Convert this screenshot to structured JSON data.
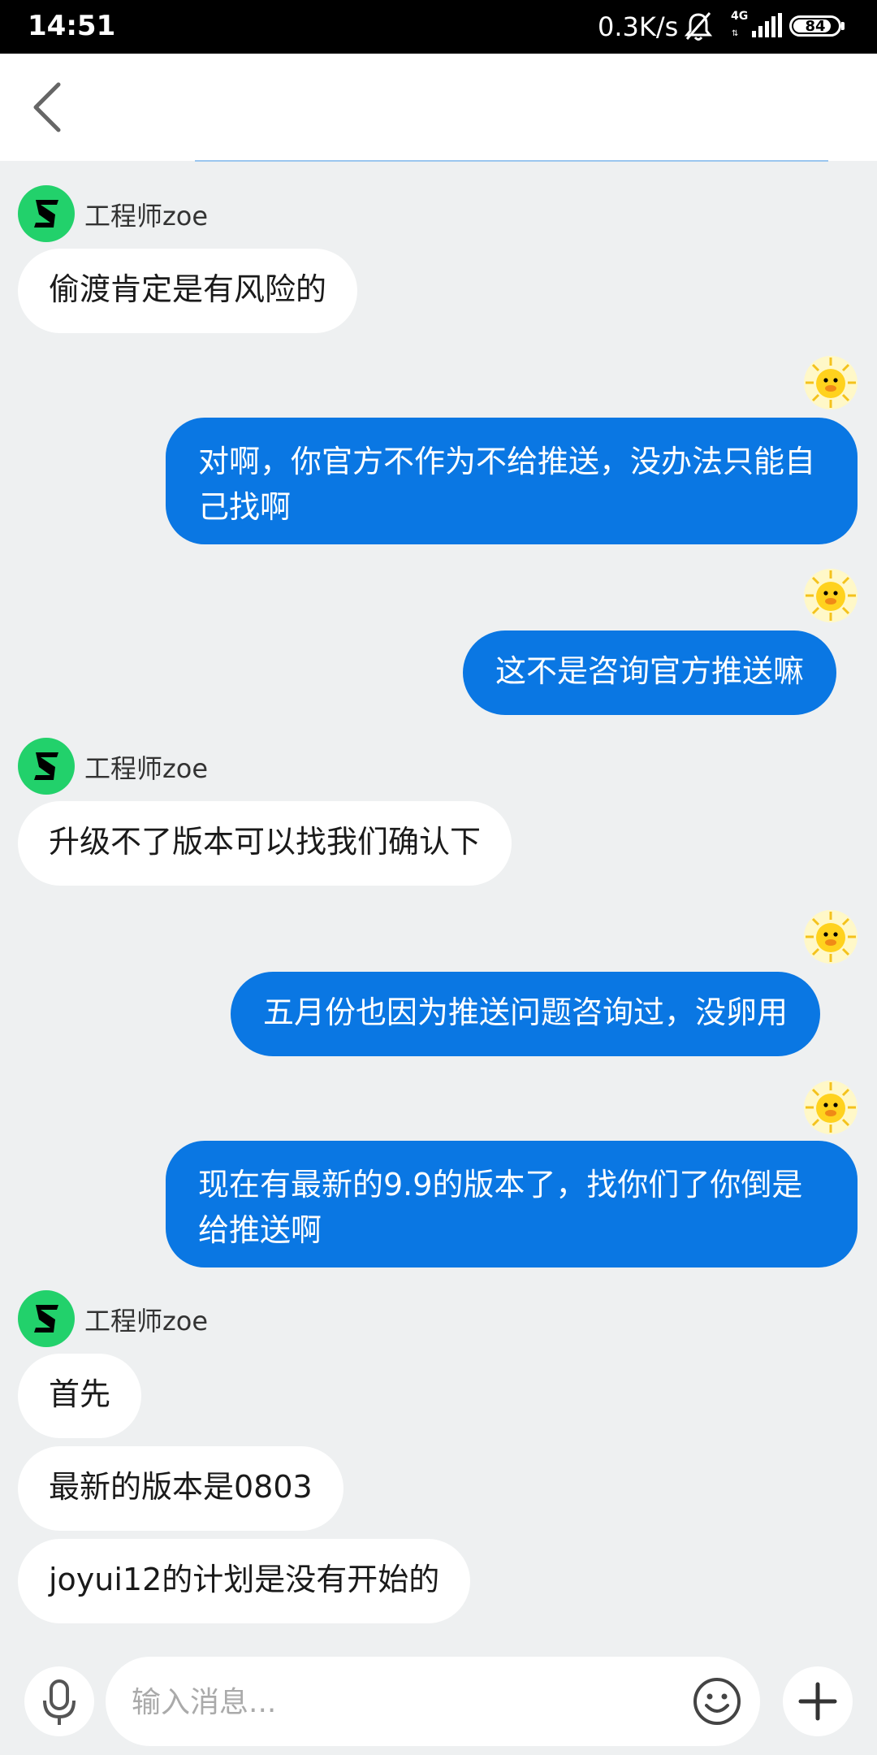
{
  "status_bar": {
    "time": "14:51",
    "net_speed": "0.3K/s",
    "network": "4G",
    "battery": "84"
  },
  "agent": {
    "name": "工程师zoe"
  },
  "messages": [
    {
      "side": "in",
      "text": "偷渡肯定是有风险的"
    },
    {
      "side": "out",
      "text": "对啊，你官方不作为不给推送，没办法只能自己找啊"
    },
    {
      "side": "out",
      "text": "这不是咨询官方推送嘛"
    },
    {
      "side": "in",
      "text": "升级不了版本可以找我们确认下"
    },
    {
      "side": "out",
      "text": "五月份也因为推送问题咨询过，没卵用"
    },
    {
      "side": "out",
      "text": "现在有最新的9.9的版本了，找你们了你倒是给推送啊"
    },
    {
      "side": "in",
      "text": "首先"
    },
    {
      "side": "in",
      "text": "最新的版本是0803"
    },
    {
      "side": "in",
      "text": "joyui12的计划是没有开始的"
    }
  ],
  "input": {
    "placeholder": "输入消息..."
  },
  "colors": {
    "outgoing_bubble": "#0a77e3",
    "agent_avatar": "#22d16b",
    "background": "#eef0f1"
  },
  "icons": [
    "back-icon",
    "mic-icon",
    "emoji-icon",
    "plus-icon",
    "mute-icon",
    "signal-icon",
    "battery-icon"
  ]
}
